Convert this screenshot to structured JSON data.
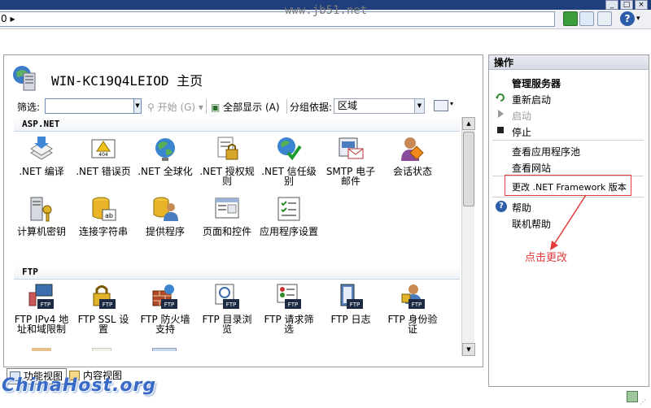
{
  "window": {
    "title_watermark": "www.jb51.net",
    "address_value": "0 ▸"
  },
  "page": {
    "title": "WIN-KC19Q4LEIOD 主页"
  },
  "filter": {
    "label": "筛选:",
    "value": "",
    "start_label": "开始 (G)",
    "show_all_label": "全部显示 (A)",
    "group_by_label": "分组依据:",
    "group_value": "区域"
  },
  "sections": [
    {
      "name": "ASP.NET",
      "items": [
        {
          "label": ".NET 编译",
          "icon": "compile-icon"
        },
        {
          "label": ".NET 错误页",
          "icon": "error-page-icon"
        },
        {
          "label": ".NET 全球化",
          "icon": "globe-icon"
        },
        {
          "label": ".NET 授权规则",
          "icon": "authorization-icon"
        },
        {
          "label": ".NET 信任级别",
          "icon": "trust-level-icon"
        },
        {
          "label": "SMTP 电子邮件",
          "icon": "smtp-email-icon"
        },
        {
          "label": "会话状态",
          "icon": "session-state-icon"
        },
        {
          "label": "计算机密钥",
          "icon": "machine-key-icon"
        },
        {
          "label": "连接字符串",
          "icon": "connection-string-icon"
        },
        {
          "label": "提供程序",
          "icon": "providers-icon"
        },
        {
          "label": "页面和控件",
          "icon": "pages-controls-icon"
        },
        {
          "label": "应用程序设置",
          "icon": "app-settings-icon"
        }
      ]
    },
    {
      "name": "FTP",
      "items": [
        {
          "label": "FTP IPv4 地址和域限制",
          "icon": "ftp-ip-restrictions-icon"
        },
        {
          "label": "FTP SSL 设置",
          "icon": "ftp-ssl-icon"
        },
        {
          "label": "FTP 防火墙支持",
          "icon": "ftp-firewall-icon"
        },
        {
          "label": "FTP 目录浏览",
          "icon": "ftp-directory-browsing-icon"
        },
        {
          "label": "FTP 请求筛选",
          "icon": "ftp-request-filtering-icon"
        },
        {
          "label": "FTP 日志",
          "icon": "ftp-logging-icon"
        },
        {
          "label": "FTP 身份验证",
          "icon": "ftp-authentication-icon"
        }
      ]
    }
  ],
  "tabs": {
    "features_view": "功能视图",
    "content_view": "内容视图"
  },
  "actions": {
    "title": "操作",
    "manage_server": "管理服务器",
    "restart": "重新启动",
    "start": "启动",
    "stop": "停止",
    "view_app_pools": "查看应用程序池",
    "view_sites": "查看网站",
    "change_framework": "更改 .NET Framework 版本",
    "help": "帮助",
    "online_help": "联机帮助"
  },
  "annotation": {
    "text": "点击更改",
    "color": "#e23b3b"
  },
  "bottom_watermark": "ChinaHost.org"
}
